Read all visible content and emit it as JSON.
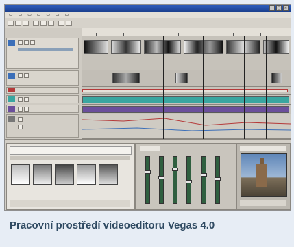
{
  "caption": "Pracovní prostředí videoeditoru Vegas 4.0",
  "colors": {
    "card_background": "#e7edf5",
    "caption_text": "#2f4a62",
    "track_video": "#3c6fb8",
    "track_audio_teal": "#3aa6a0",
    "track_audio_purple": "#6b4f9c",
    "track_red": "#b53a3a"
  },
  "icons": [
    "close-icon",
    "maximize-icon",
    "minimize-icon",
    "play-icon",
    "stop-icon"
  ]
}
